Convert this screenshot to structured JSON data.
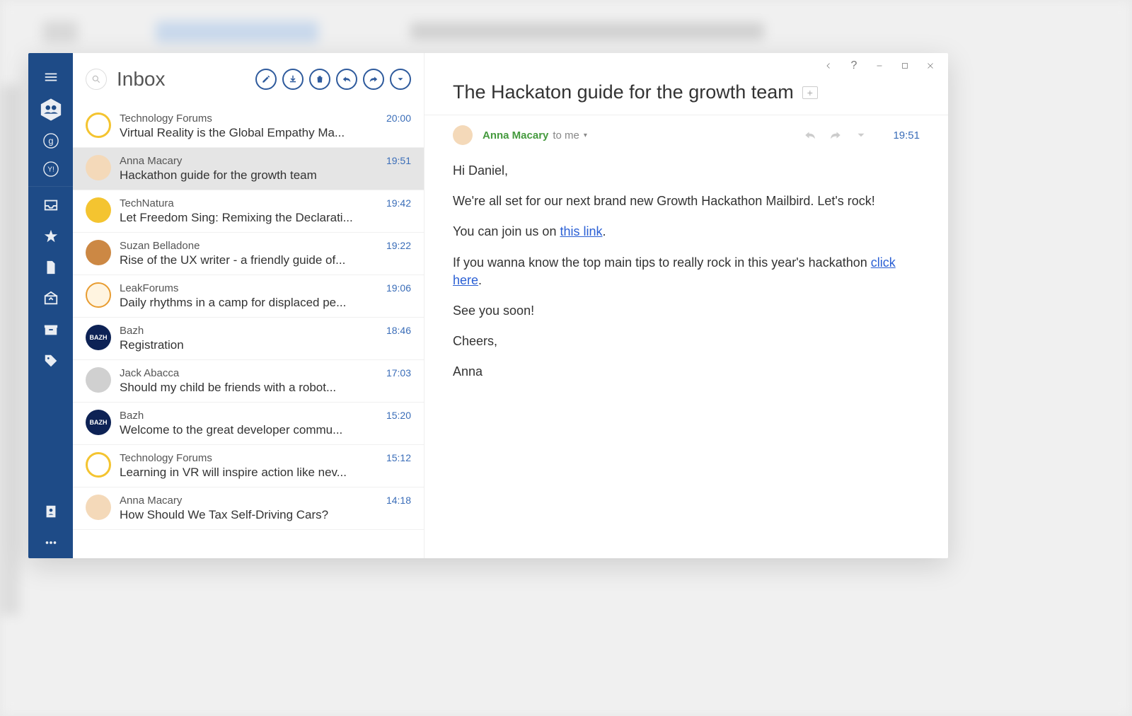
{
  "inbox_title": "Inbox",
  "emails": [
    {
      "sender": "Technology Forums",
      "subject": "Virtual Reality is the Global Empathy Ma...",
      "time": "20:00",
      "avatar": "tech"
    },
    {
      "sender": "Anna Macary",
      "subject": "Hackathon guide for the growth team",
      "time": "19:51",
      "avatar": "anna",
      "selected": true
    },
    {
      "sender": "TechNatura",
      "subject": "Let Freedom Sing: Remixing the Declarati...",
      "time": "19:42",
      "avatar": "natura"
    },
    {
      "sender": "Suzan Belladone",
      "subject": "Rise of the UX writer - a friendly guide of...",
      "time": "19:22",
      "avatar": "suzan"
    },
    {
      "sender": "LeakForums",
      "subject": "Daily rhythms in a camp for displaced pe...",
      "time": "19:06",
      "avatar": "leak"
    },
    {
      "sender": "Bazh",
      "subject": "Registration",
      "time": "18:46",
      "avatar": "bazh"
    },
    {
      "sender": "Jack Abacca",
      "subject": "Should my child be friends with a robot...",
      "time": "17:03",
      "avatar": "jack"
    },
    {
      "sender": "Bazh",
      "subject": "Welcome to the great developer commu...",
      "time": "15:20",
      "avatar": "bazh"
    },
    {
      "sender": "Technology Forums",
      "subject": "Learning in VR will inspire action like nev...",
      "time": "15:12",
      "avatar": "tech"
    },
    {
      "sender": "Anna Macary",
      "subject": "How Should We Tax Self-Driving Cars?",
      "time": "14:18",
      "avatar": "anna"
    }
  ],
  "reader": {
    "title": "The Hackaton guide for the growth team",
    "sender_name": "Anna Macary",
    "recipient": "to me",
    "time": "19:51",
    "greeting": "Hi Daniel,",
    "p1": "We're all set for our next brand new Growth Hackathon Mailbird. Let's rock!",
    "p2_pre": "You can join us on ",
    "p2_link": "this link",
    "p2_post": ".",
    "p3_pre": "If you wanna know the top main tips to really rock in this year's hackathon ",
    "p3_link": "click here",
    "p3_post": ".",
    "p4": "See you soon!",
    "p5": "Cheers,",
    "p6": "Anna"
  },
  "icons": {
    "plus": "+"
  }
}
